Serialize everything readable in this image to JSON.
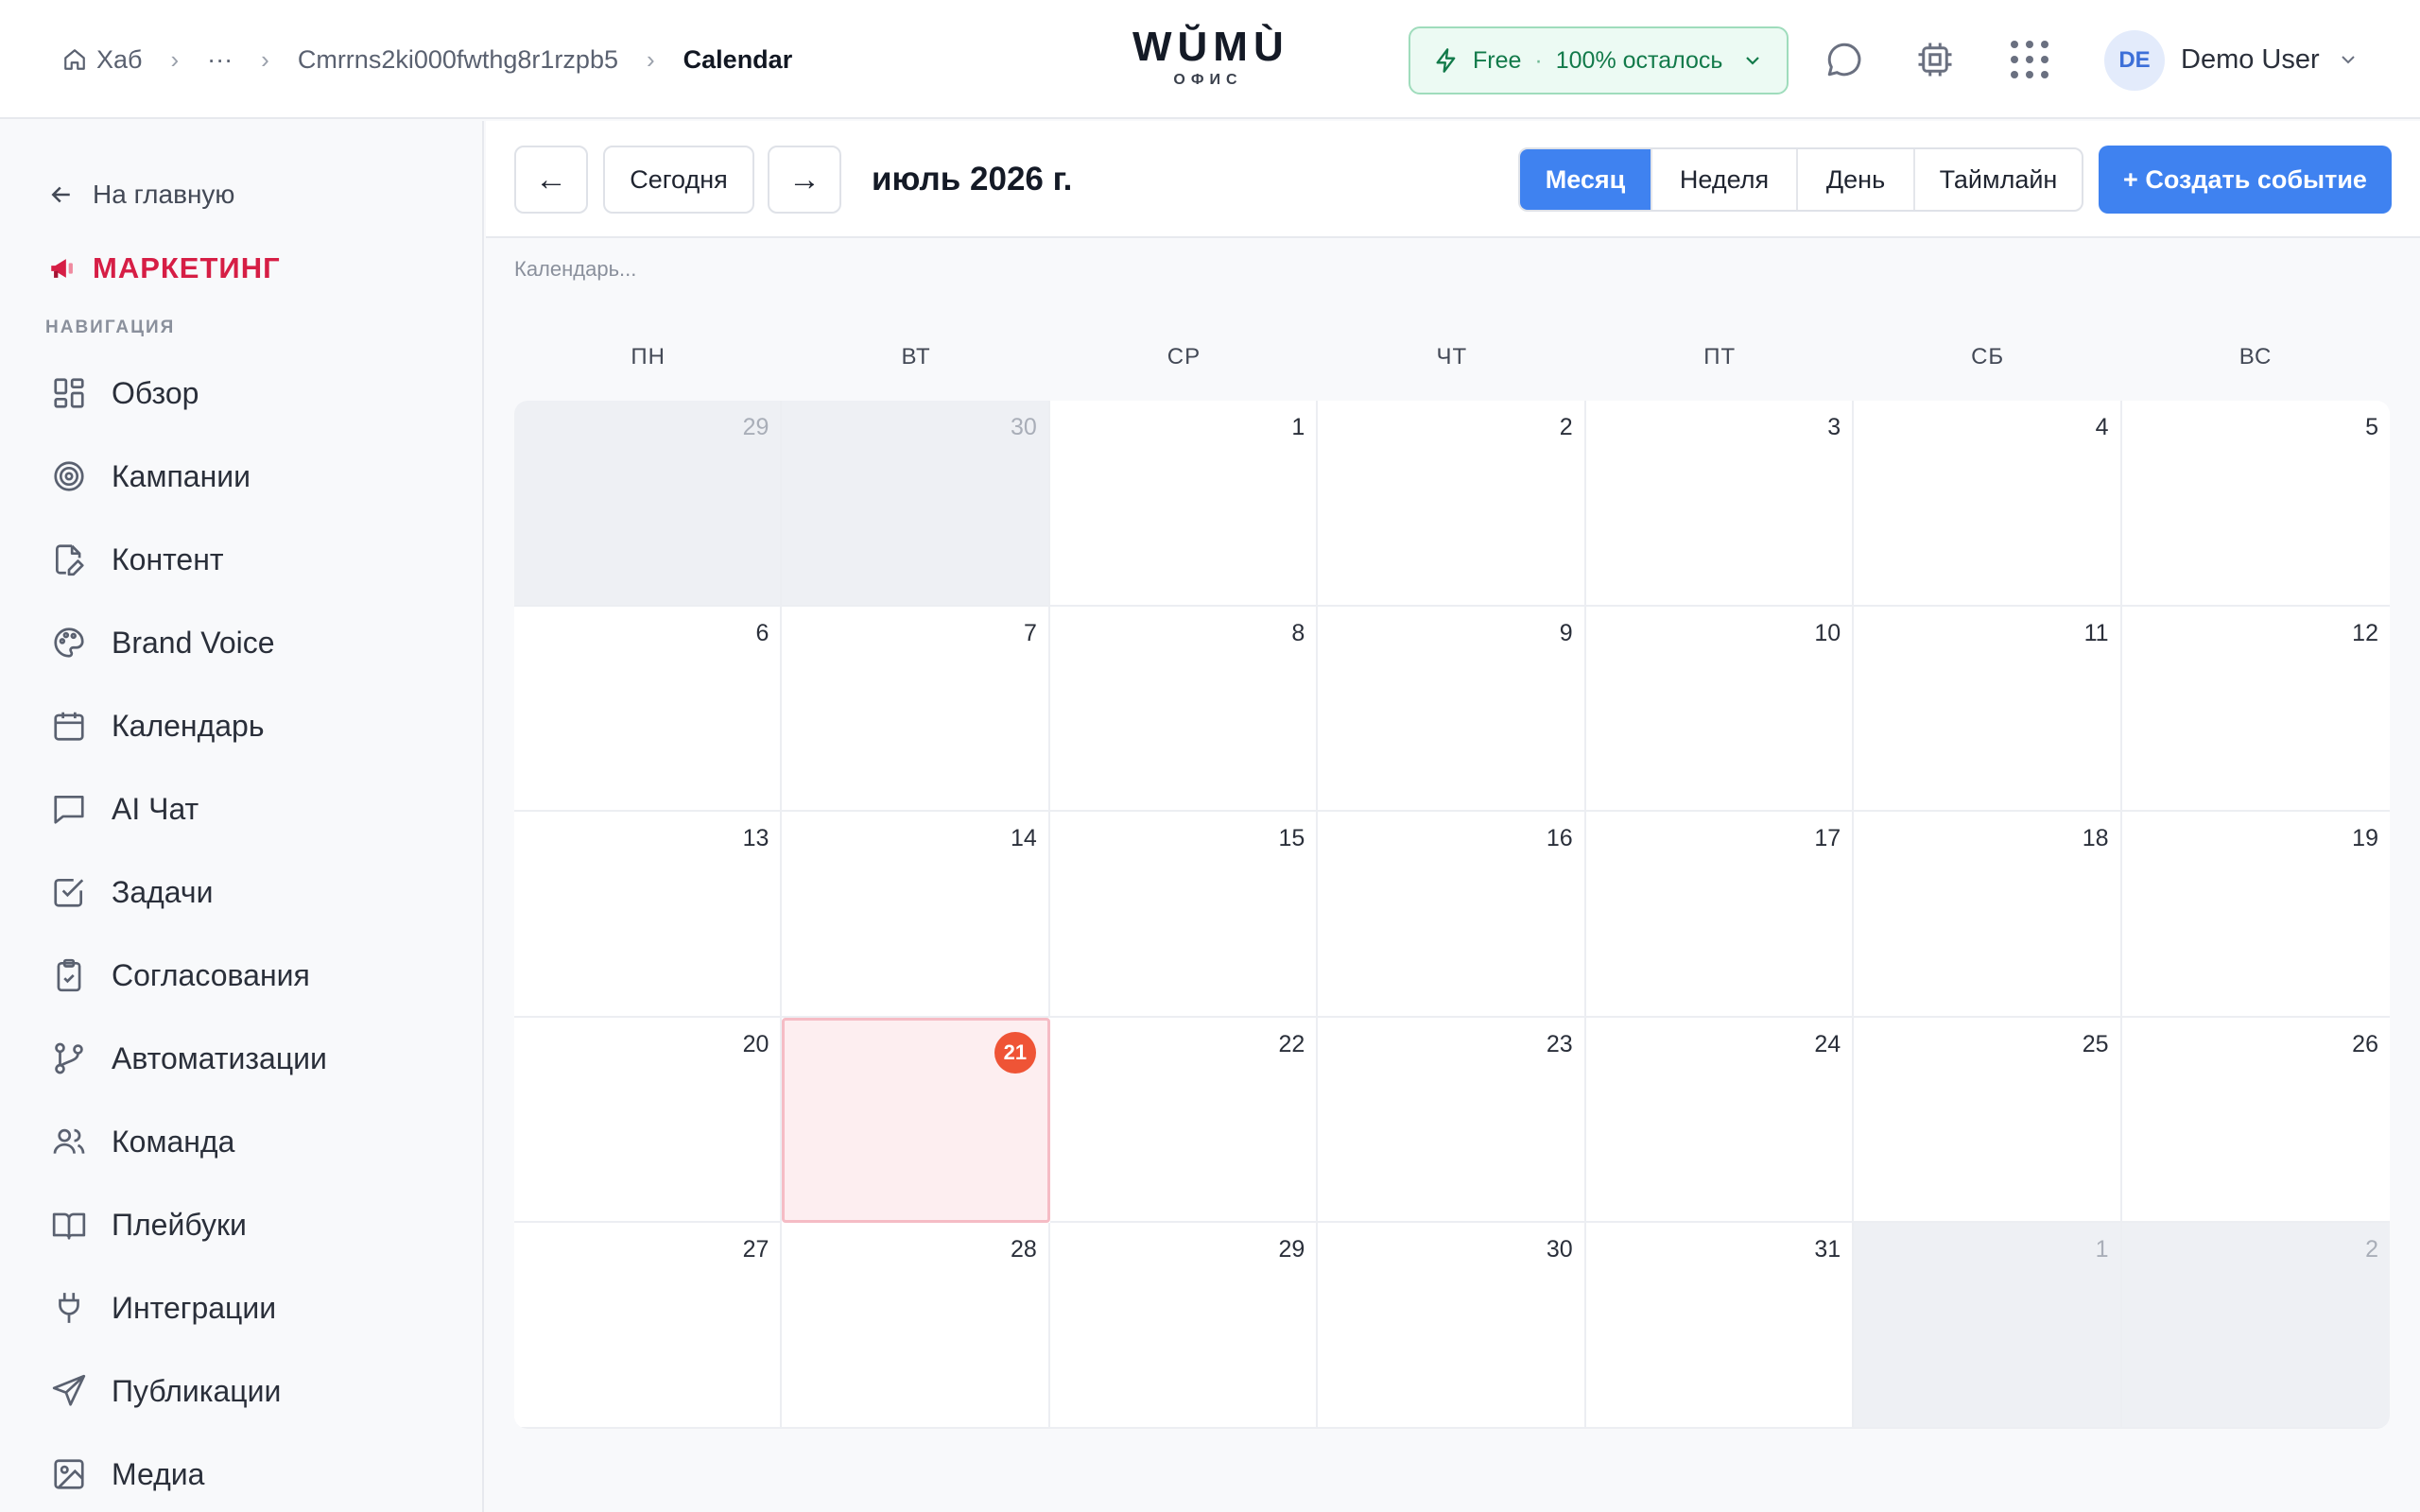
{
  "header": {
    "breadcrumb": {
      "home": "Хаб",
      "ellipsis": "···",
      "id": "Cmrrns2ki000fwthg8r1rzpb5",
      "current": "Calendar"
    },
    "logo": {
      "word": "WŬMÙ",
      "sub": "ОФИС"
    },
    "plan": {
      "name": "Free",
      "separator": "·",
      "remaining": "100% осталось"
    },
    "user": {
      "initials": "DE",
      "name": "Demo User"
    }
  },
  "sidebar": {
    "back_label": "На главную",
    "section_title": "МАРКЕТИНГ",
    "nav_heading": "НАВИГАЦИЯ",
    "items": [
      {
        "label": "Обзор",
        "icon": "dashboard-icon"
      },
      {
        "label": "Кампании",
        "icon": "target-icon"
      },
      {
        "label": "Контент",
        "icon": "file-edit-icon"
      },
      {
        "label": "Brand Voice",
        "icon": "palette-icon"
      },
      {
        "label": "Календарь",
        "icon": "calendar-icon"
      },
      {
        "label": "AI Чат",
        "icon": "chat-icon"
      },
      {
        "label": "Задачи",
        "icon": "checkbox-icon"
      },
      {
        "label": "Согласования",
        "icon": "clipboard-check-icon"
      },
      {
        "label": "Автоматизации",
        "icon": "git-branch-icon"
      },
      {
        "label": "Команда",
        "icon": "users-icon"
      },
      {
        "label": "Плейбуки",
        "icon": "book-icon"
      },
      {
        "label": "Интеграции",
        "icon": "plug-icon"
      },
      {
        "label": "Публикации",
        "icon": "send-icon"
      },
      {
        "label": "Медиа",
        "icon": "image-icon"
      }
    ]
  },
  "toolbar": {
    "prev": "←",
    "today": "Сегодня",
    "next": "→",
    "month_title": "июль 2026 г.",
    "views": [
      "Месяц",
      "Неделя",
      "День",
      "Таймлайн"
    ],
    "active_view": "Месяц",
    "create_label": "+ Создать событие"
  },
  "calendar": {
    "label": "Календарь...",
    "weekdays": [
      "ПН",
      "ВТ",
      "СР",
      "ЧТ",
      "ПТ",
      "СБ",
      "ВС"
    ],
    "today": 21,
    "days": [
      {
        "n": "29",
        "out": true
      },
      {
        "n": "30",
        "out": true
      },
      {
        "n": "1"
      },
      {
        "n": "2"
      },
      {
        "n": "3"
      },
      {
        "n": "4"
      },
      {
        "n": "5"
      },
      {
        "n": "6"
      },
      {
        "n": "7"
      },
      {
        "n": "8"
      },
      {
        "n": "9"
      },
      {
        "n": "10"
      },
      {
        "n": "11"
      },
      {
        "n": "12"
      },
      {
        "n": "13"
      },
      {
        "n": "14"
      },
      {
        "n": "15"
      },
      {
        "n": "16"
      },
      {
        "n": "17"
      },
      {
        "n": "18"
      },
      {
        "n": "19"
      },
      {
        "n": "20"
      },
      {
        "n": "21",
        "today": true
      },
      {
        "n": "22"
      },
      {
        "n": "23"
      },
      {
        "n": "24"
      },
      {
        "n": "25"
      },
      {
        "n": "26"
      },
      {
        "n": "27"
      },
      {
        "n": "28"
      },
      {
        "n": "29"
      },
      {
        "n": "30"
      },
      {
        "n": "31"
      },
      {
        "n": "1",
        "out": true
      },
      {
        "n": "2",
        "out": true
      }
    ]
  },
  "colors": {
    "accent": "#3f82f0",
    "brand_red": "#d61e45",
    "today_badge": "#ef5436",
    "plan_green": "#127a4a"
  }
}
